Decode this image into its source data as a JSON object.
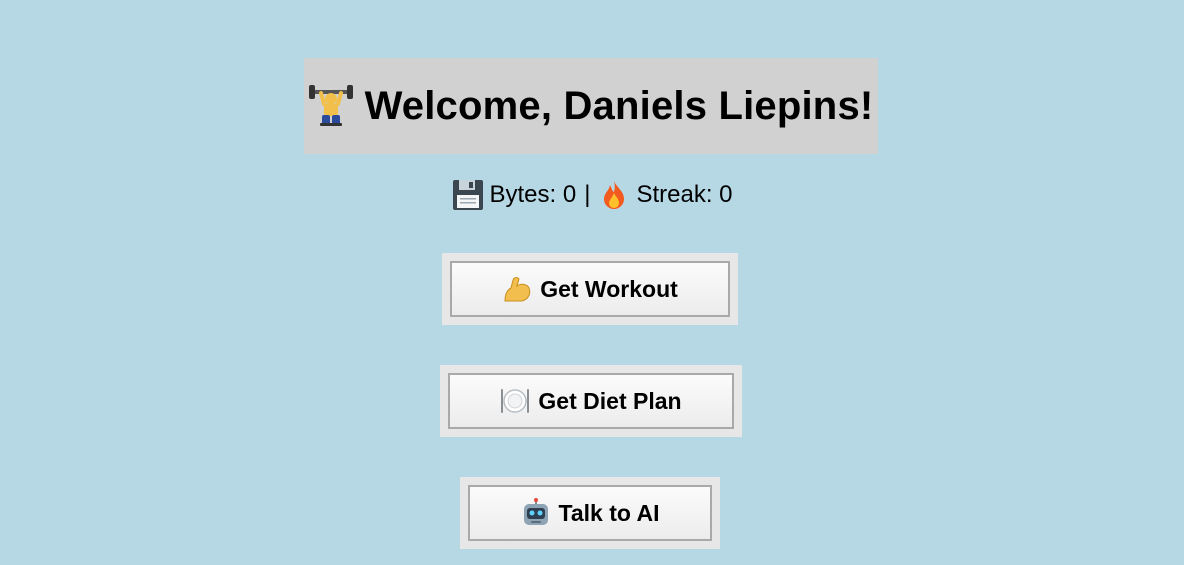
{
  "header": {
    "icon": "weightlifter-icon",
    "title": "Welcome, Daniels Liepins!"
  },
  "stats": {
    "bytes_icon": "floppy-disk-icon",
    "bytes_text": "Bytes: 0",
    "separator": "|",
    "streak_icon": "fire-icon",
    "streak_text": "Streak: 0"
  },
  "buttons": {
    "workout": {
      "icon": "flexed-biceps-icon",
      "label": "Get Workout"
    },
    "diet": {
      "icon": "plate-cutlery-icon",
      "label": "Get Diet Plan"
    },
    "ai": {
      "icon": "robot-icon",
      "label": "Talk to AI"
    }
  },
  "colors": {
    "background": "#b6d8e4",
    "header_bg": "#d1d1d1",
    "button_outer": "#e7e7e7",
    "button_border": "#a9a9a9"
  }
}
